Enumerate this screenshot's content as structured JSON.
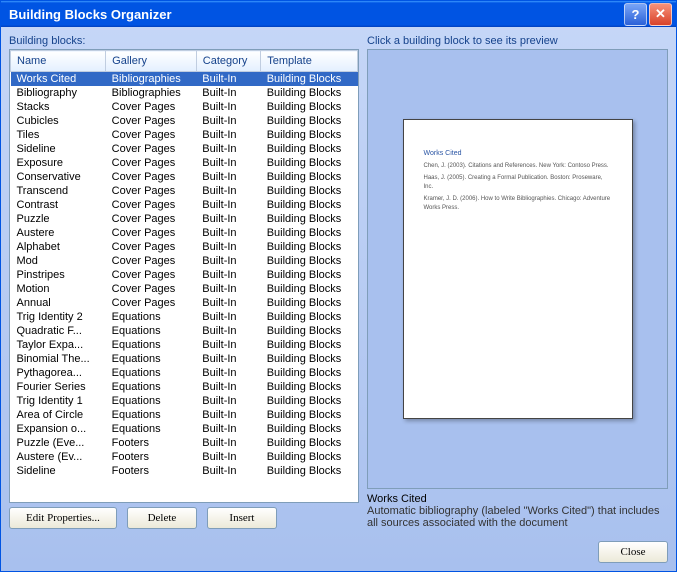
{
  "window": {
    "title": "Building Blocks Organizer"
  },
  "labels": {
    "building_blocks": "Building blocks:",
    "preview_hint": "Click a building block to see its preview"
  },
  "columns": {
    "name": "Name",
    "gallery": "Gallery",
    "category": "Category",
    "template": "Template"
  },
  "rows": [
    {
      "name": "Works Cited",
      "gallery": "Bibliographies",
      "category": "Built-In",
      "template": "Building Blocks",
      "selected": true
    },
    {
      "name": "Bibliography",
      "gallery": "Bibliographies",
      "category": "Built-In",
      "template": "Building Blocks"
    },
    {
      "name": "Stacks",
      "gallery": "Cover Pages",
      "category": "Built-In",
      "template": "Building Blocks"
    },
    {
      "name": "Cubicles",
      "gallery": "Cover Pages",
      "category": "Built-In",
      "template": "Building Blocks"
    },
    {
      "name": "Tiles",
      "gallery": "Cover Pages",
      "category": "Built-In",
      "template": "Building Blocks"
    },
    {
      "name": "Sideline",
      "gallery": "Cover Pages",
      "category": "Built-In",
      "template": "Building Blocks"
    },
    {
      "name": "Exposure",
      "gallery": "Cover Pages",
      "category": "Built-In",
      "template": "Building Blocks"
    },
    {
      "name": "Conservative",
      "gallery": "Cover Pages",
      "category": "Built-In",
      "template": "Building Blocks"
    },
    {
      "name": "Transcend",
      "gallery": "Cover Pages",
      "category": "Built-In",
      "template": "Building Blocks"
    },
    {
      "name": "Contrast",
      "gallery": "Cover Pages",
      "category": "Built-In",
      "template": "Building Blocks"
    },
    {
      "name": "Puzzle",
      "gallery": "Cover Pages",
      "category": "Built-In",
      "template": "Building Blocks"
    },
    {
      "name": "Austere",
      "gallery": "Cover Pages",
      "category": "Built-In",
      "template": "Building Blocks"
    },
    {
      "name": "Alphabet",
      "gallery": "Cover Pages",
      "category": "Built-In",
      "template": "Building Blocks"
    },
    {
      "name": "Mod",
      "gallery": "Cover Pages",
      "category": "Built-In",
      "template": "Building Blocks"
    },
    {
      "name": "Pinstripes",
      "gallery": "Cover Pages",
      "category": "Built-In",
      "template": "Building Blocks"
    },
    {
      "name": "Motion",
      "gallery": "Cover Pages",
      "category": "Built-In",
      "template": "Building Blocks"
    },
    {
      "name": "Annual",
      "gallery": "Cover Pages",
      "category": "Built-In",
      "template": "Building Blocks"
    },
    {
      "name": "Trig Identity 2",
      "gallery": "Equations",
      "category": "Built-In",
      "template": "Building Blocks"
    },
    {
      "name": "Quadratic F...",
      "gallery": "Equations",
      "category": "Built-In",
      "template": "Building Blocks"
    },
    {
      "name": "Taylor Expa...",
      "gallery": "Equations",
      "category": "Built-In",
      "template": "Building Blocks"
    },
    {
      "name": "Binomial The...",
      "gallery": "Equations",
      "category": "Built-In",
      "template": "Building Blocks"
    },
    {
      "name": "Pythagorea...",
      "gallery": "Equations",
      "category": "Built-In",
      "template": "Building Blocks"
    },
    {
      "name": "Fourier Series",
      "gallery": "Equations",
      "category": "Built-In",
      "template": "Building Blocks"
    },
    {
      "name": "Trig Identity 1",
      "gallery": "Equations",
      "category": "Built-In",
      "template": "Building Blocks"
    },
    {
      "name": "Area of Circle",
      "gallery": "Equations",
      "category": "Built-In",
      "template": "Building Blocks"
    },
    {
      "name": "Expansion o...",
      "gallery": "Equations",
      "category": "Built-In",
      "template": "Building Blocks"
    },
    {
      "name": "Puzzle (Eve...",
      "gallery": "Footers",
      "category": "Built-In",
      "template": "Building Blocks"
    },
    {
      "name": "Austere (Ev...",
      "gallery": "Footers",
      "category": "Built-In",
      "template": "Building Blocks"
    },
    {
      "name": "Sideline",
      "gallery": "Footers",
      "category": "Built-In",
      "template": "Building Blocks"
    }
  ],
  "preview": {
    "title": "Works Cited",
    "lines": [
      "Chen, J. (2003). Citations and References. New York: Contoso Press.",
      "Haas, J. (2005). Creating a Formal Publication. Boston: Proseware, Inc.",
      "Kramer, J. D. (2006). How to Write Bibliographies. Chicago: Adventure Works Press."
    ]
  },
  "description": {
    "title": "Works Cited",
    "text": "Automatic bibliography (labeled \"Works Cited\") that includes all sources associated with the document"
  },
  "buttons": {
    "edit": "Edit Properties...",
    "delete": "Delete",
    "insert": "Insert",
    "close": "Close"
  }
}
